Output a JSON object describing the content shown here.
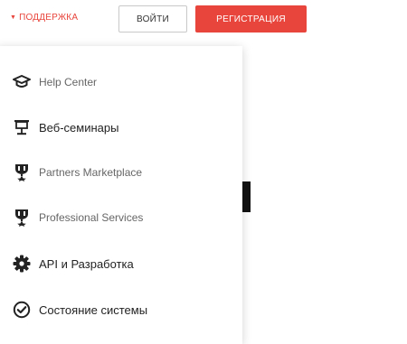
{
  "header": {
    "support_label": "ПОДДЕРЖКА",
    "login_label": "ВОЙТИ",
    "register_label": "РЕГИСТРАЦИЯ"
  },
  "menu": {
    "items": [
      {
        "label": "Help Center",
        "icon": "graduation-cap-icon"
      },
      {
        "label": "Веб-семинары",
        "icon": "presentation-icon"
      },
      {
        "label": "Partners Marketplace",
        "icon": "award-icon"
      },
      {
        "label": "Professional Services",
        "icon": "award-icon"
      },
      {
        "label": "API и Разработка",
        "icon": "gear-icon"
      },
      {
        "label": "Состояние системы",
        "icon": "check-circle-icon"
      }
    ]
  },
  "colors": {
    "accent": "#e8453c",
    "text": "#222222"
  }
}
